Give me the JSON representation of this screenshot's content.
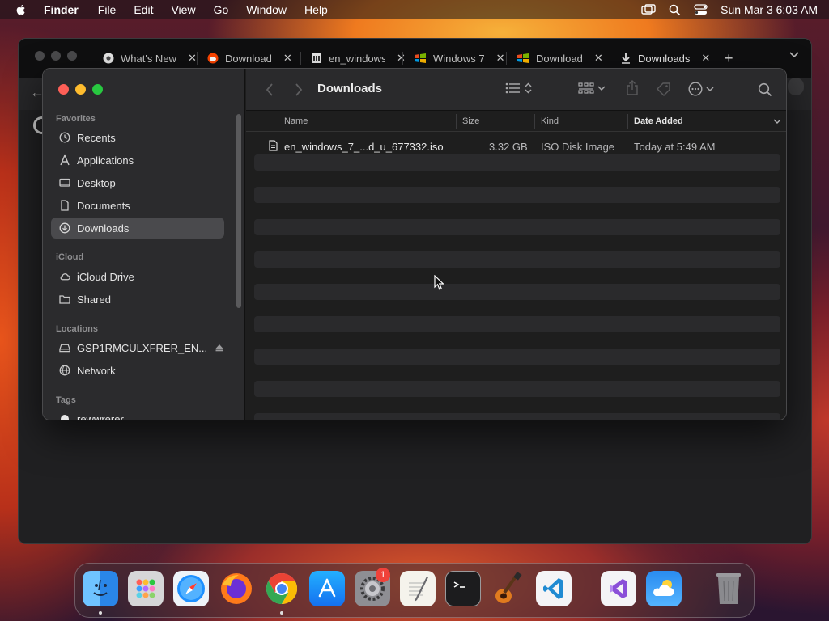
{
  "menubar": {
    "app_name": "Finder",
    "items": [
      "File",
      "Edit",
      "View",
      "Go",
      "Window",
      "Help"
    ],
    "clock": "Sun Mar 3  6:03 AM"
  },
  "browser": {
    "tabs": [
      {
        "label": "What's New",
        "icon": "chrome-icon"
      },
      {
        "label": "Download",
        "icon": "reddit-icon"
      },
      {
        "label": "en_windows",
        "icon": "archive-icon"
      },
      {
        "label": "Windows 7",
        "icon": "windows-icon"
      },
      {
        "label": "Download",
        "icon": "windows-icon"
      },
      {
        "label": "Downloads",
        "icon": "download-icon"
      }
    ],
    "new_tab": "+"
  },
  "finder": {
    "title": "Downloads",
    "sidebar": {
      "favorites_title": "Favorites",
      "favorites": [
        "Recents",
        "Applications",
        "Desktop",
        "Documents",
        "Downloads"
      ],
      "icloud_title": "iCloud",
      "icloud": [
        "iCloud Drive",
        "Shared"
      ],
      "locations_title": "Locations",
      "locations": [
        "GSP1RMCULXFRER_EN...",
        "Network"
      ],
      "tags_title": "Tags",
      "tags": [
        "rewwrerer"
      ]
    },
    "columns": {
      "name": "Name",
      "size": "Size",
      "kind": "Kind",
      "date": "Date Added"
    },
    "files": [
      {
        "name": "en_windows_7_...d_u_677332.iso",
        "size": "3.32 GB",
        "kind": "ISO Disk Image",
        "date": "Today at 5:49 AM"
      }
    ]
  },
  "dock": {
    "apps": [
      "Finder",
      "Launchpad",
      "Safari",
      "Firefox",
      "Chrome",
      "App Store",
      "System Settings",
      "TextEdit",
      "Terminal",
      "GarageBand",
      "VS Code",
      "Visual Studio",
      "Weather",
      "Trash"
    ],
    "settings_badge": "1"
  }
}
